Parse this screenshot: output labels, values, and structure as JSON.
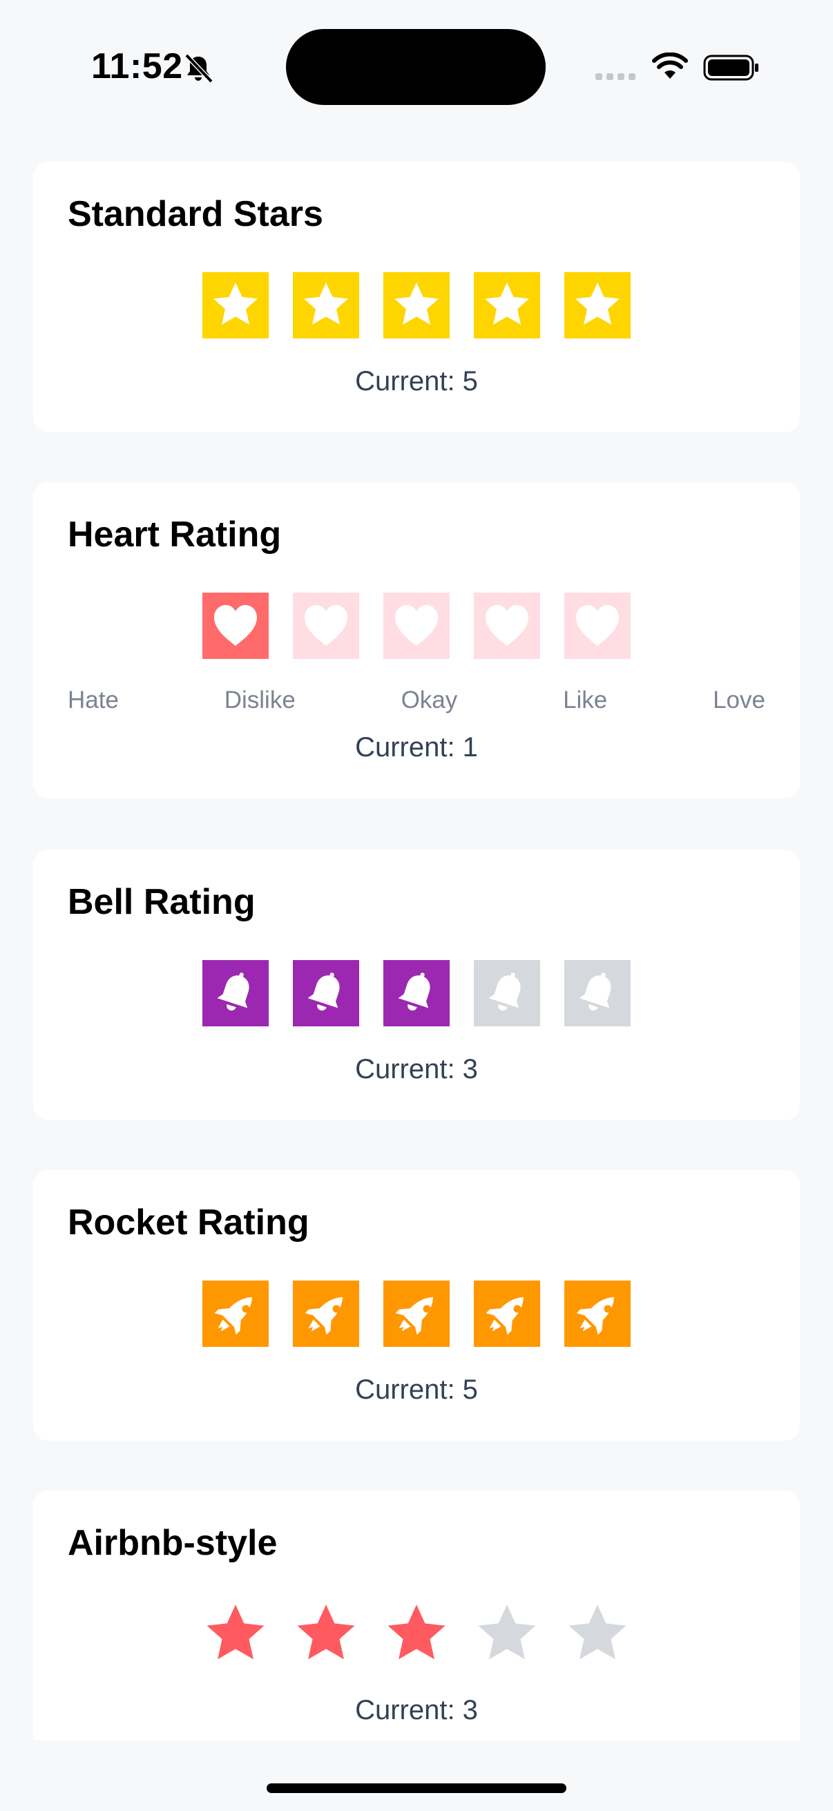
{
  "status_bar": {
    "time": "11:52",
    "icons": [
      "bell-slash-icon",
      "cellular-signal-icon",
      "wifi-icon",
      "battery-icon"
    ]
  },
  "cards": {
    "standard": {
      "title": "Standard Stars",
      "current_label": "Current: 5",
      "value": 5,
      "max": 5,
      "icon": "star-icon",
      "active_color": "#FFD500",
      "inactive_color": "#FFD500"
    },
    "heart": {
      "title": "Heart Rating",
      "current_label": "Current: 1",
      "value": 1,
      "max": 5,
      "icon": "heart-icon",
      "active_color": "#FF6B6B",
      "inactive_color": "#FFDDE2",
      "labels": [
        "Hate",
        "Dislike",
        "Okay",
        "Like",
        "Love"
      ]
    },
    "bell": {
      "title": "Bell Rating",
      "current_label": "Current: 3",
      "value": 3,
      "max": 5,
      "icon": "bell-icon",
      "active_color": "#9C27B0",
      "inactive_color": "#D5D8DC"
    },
    "rocket": {
      "title": "Rocket Rating",
      "current_label": "Current: 5",
      "value": 5,
      "max": 5,
      "icon": "rocket-icon",
      "active_color": "#FF9800",
      "inactive_color": "#FF9800"
    },
    "airbnb": {
      "title": "Airbnb-style",
      "current_label": "Current: 3",
      "value": 3,
      "max": 5,
      "icon": "star-icon",
      "active_color": "#FF5A5F",
      "inactive_color": "#D5D8DC"
    }
  }
}
